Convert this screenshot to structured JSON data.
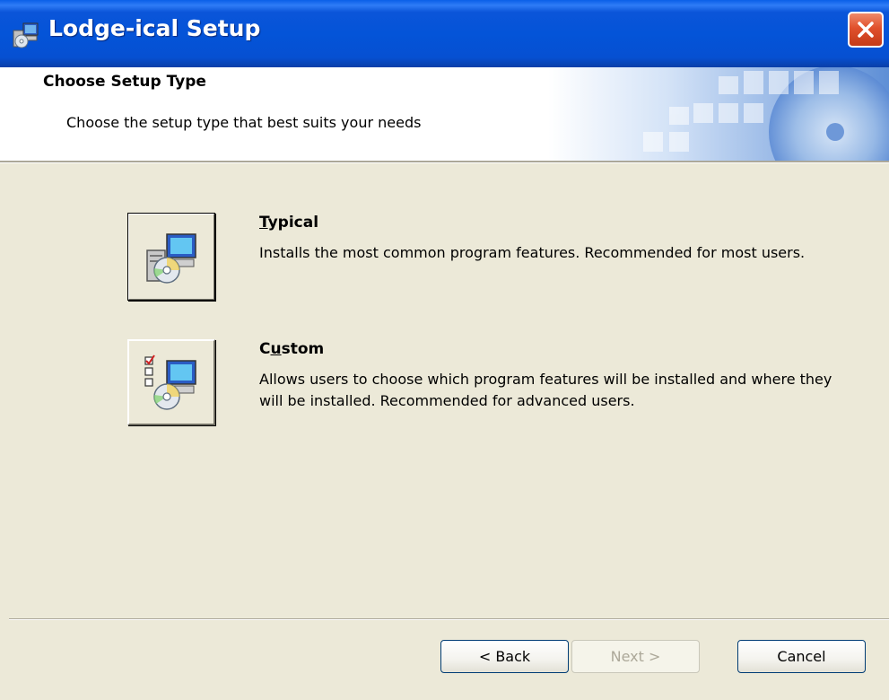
{
  "window": {
    "title": "Lodge-ical Setup"
  },
  "icons": {
    "app": "installer-icon",
    "close": "close-icon",
    "typical": "computer-cd-icon",
    "custom": "checklist-computer-cd-icon"
  },
  "banner": {
    "heading": "Choose Setup Type",
    "subheading": "Choose the setup type that best suits your needs"
  },
  "options": {
    "typical": {
      "title_first": "T",
      "title_rest": "ypical",
      "description": "Installs the most common program features. Recommended for most users."
    },
    "custom": {
      "title_first": "C",
      "title_underlined": "u",
      "title_rest": "stom",
      "description": "Allows users to choose which program features will be installed and where they will be installed. Recommended for advanced users."
    }
  },
  "buttons": {
    "back": "< Back",
    "next": "Next >",
    "cancel": "Cancel"
  },
  "colors": {
    "titlebar": "#0454d8",
    "dialog_bg": "#ece9d8",
    "close": "#e0502c"
  }
}
